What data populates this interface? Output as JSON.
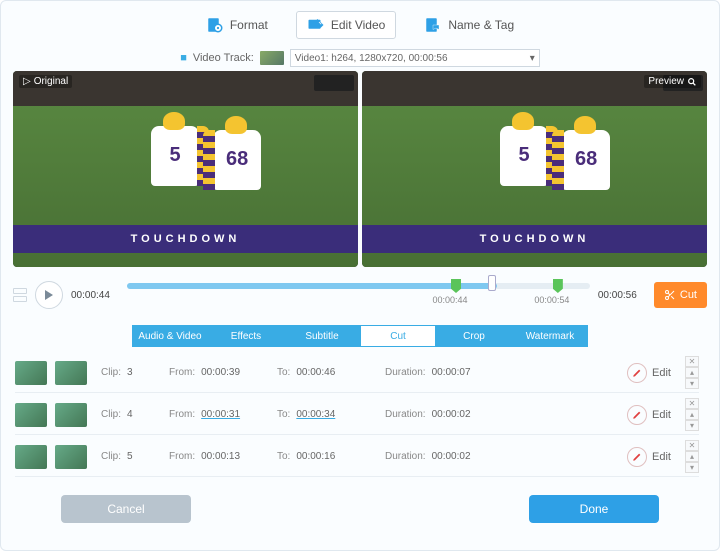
{
  "topTabs": {
    "format": "Format",
    "editVideo": "Edit Video",
    "nameTag": "Name & Tag"
  },
  "track": {
    "label": "Video Track:",
    "selected": "Video1: h264, 1280x720, 00:00:56"
  },
  "preview": {
    "originalTag": "Original",
    "previewTag": "Preview",
    "bannerText": "TOUCHDOWN",
    "jersey1": "5",
    "jersey2": "68"
  },
  "timeline": {
    "current": "00:00:44",
    "total": "00:00:56",
    "ticks": {
      "t1": "00:00:44",
      "t2": "00:00:54"
    },
    "cutLabel": "Cut"
  },
  "subTabs": {
    "audioVideo": "Audio & Video",
    "effects": "Effects",
    "subtitle": "Subtitle",
    "cut": "Cut",
    "crop": "Crop",
    "watermark": "Watermark"
  },
  "labels": {
    "clip": "Clip:",
    "from": "From:",
    "to": "To:",
    "duration": "Duration:",
    "edit": "Edit"
  },
  "clips": [
    {
      "n": "3",
      "from": "00:00:39",
      "to": "00:00:46",
      "dur": "00:00:07"
    },
    {
      "n": "4",
      "from": "00:00:31",
      "to": "00:00:34",
      "dur": "00:00:02"
    },
    {
      "n": "5",
      "from": "00:00:13",
      "to": "00:00:16",
      "dur": "00:00:02"
    }
  ],
  "buttons": {
    "cancel": "Cancel",
    "done": "Done"
  }
}
